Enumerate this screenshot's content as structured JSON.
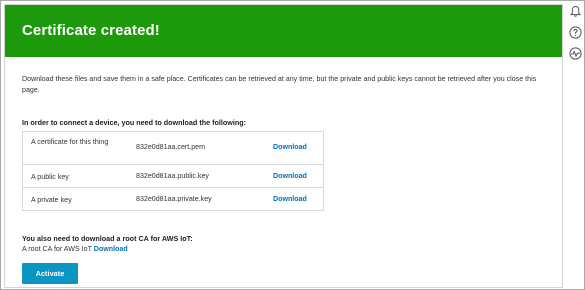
{
  "header": {
    "title": "Certificate created!"
  },
  "description": "Download these files and save them in a safe place. Certificates can be retrieved at any time, but the private and public keys cannot be retrieved after you close this page.",
  "connect_section": {
    "title": "In order to connect a device, you need to download the following:",
    "rows": [
      {
        "label": "A certificate for this thing",
        "file": "832e0d81aa.cert.pem",
        "action": "Download"
      },
      {
        "label": "A public key",
        "file": "832e0d81aa.public.key",
        "action": "Download"
      },
      {
        "label": "A private key",
        "file": "832e0d81aa.private.key",
        "action": "Download"
      }
    ]
  },
  "root_ca": {
    "title": "You also need to download a root CA for AWS IoT:",
    "text": "A root CA for AWS IoT ",
    "link": "Download"
  },
  "activate_button": "Activate",
  "side_icons": [
    "bell-icon",
    "help-icon",
    "activity-icon"
  ],
  "colors": {
    "header_green": "#1d9a0b",
    "link_blue": "#0073bb",
    "button_blue": "#0a96c4"
  }
}
